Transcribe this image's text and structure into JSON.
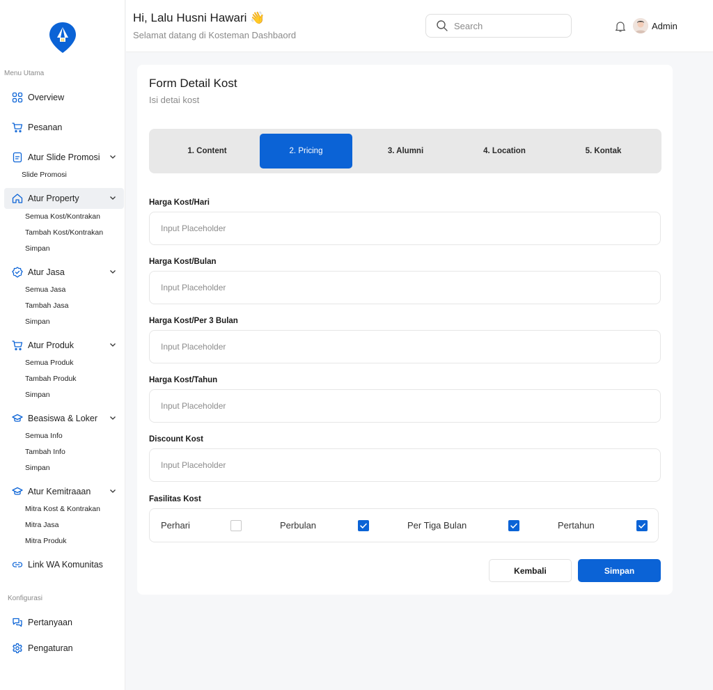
{
  "sidebar": {
    "menu_heading": "Menu Utama",
    "config_heading": "Konfigurasi",
    "items": [
      {
        "label": "Overview"
      },
      {
        "label": "Pesanan"
      },
      {
        "label": "Atur Slide Promosi",
        "children": [
          "Slide Promosi"
        ]
      },
      {
        "label": "Atur Property",
        "children": [
          "Semua Kost/Kontrakan",
          "Tambah Kost/Kontrakan",
          "Simpan"
        ]
      },
      {
        "label": "Atur Jasa",
        "children": [
          "Semua Jasa",
          "Tambah Jasa",
          "Simpan"
        ]
      },
      {
        "label": "Atur Produk",
        "children": [
          "Semua Produk",
          "Tambah Produk",
          "Simpan"
        ]
      },
      {
        "label": "Beasiswa & Loker",
        "children": [
          "Semua Info",
          "Tambah Info",
          "Simpan"
        ]
      },
      {
        "label": "Atur Kemitraaan",
        "children": [
          "Mitra Kost & Kontrakan",
          "Mitra Jasa",
          "Mitra Produk"
        ]
      },
      {
        "label": "Link WA Komunitas"
      }
    ],
    "config_items": [
      {
        "label": "Pertanyaan"
      },
      {
        "label": "Pengaturan"
      }
    ]
  },
  "header": {
    "greeting": "Hi, Lalu Husni Hawari 👋",
    "subtitle": "Selamat datang di Kosteman Dashbaord",
    "search_placeholder": "Search",
    "user": "Admin"
  },
  "form": {
    "title": "Form Detail Kost",
    "subtitle": "Isi detai kost",
    "steps": [
      "1. Content",
      "2. Pricing",
      "3. Alumni",
      "4. Location",
      "5. Kontak"
    ],
    "active_step": "2. Pricing",
    "fields": [
      {
        "label": "Harga Kost/Hari",
        "placeholder": "Input Placeholder"
      },
      {
        "label": "Harga Kost/Bulan",
        "placeholder": "Input Placeholder"
      },
      {
        "label": "Harga Kost/Per 3 Bulan",
        "placeholder": "Input Placeholder"
      },
      {
        "label": "Harga Kost/Tahun",
        "placeholder": "Input Placeholder"
      },
      {
        "label": "Discount Kost",
        "placeholder": "Input Placeholder"
      }
    ],
    "facilities_label": "Fasilitas Kost",
    "facilities": [
      {
        "label": "Perhari",
        "checked": false
      },
      {
        "label": "Perbulan",
        "checked": true
      },
      {
        "label": "Per Tiga Bulan",
        "checked": true
      },
      {
        "label": "Pertahun",
        "checked": true
      }
    ],
    "back_label": "Kembali",
    "save_label": "Simpan"
  },
  "colors": {
    "accent": "#0b63d6",
    "active_nav_bg": "#eef0f3"
  }
}
